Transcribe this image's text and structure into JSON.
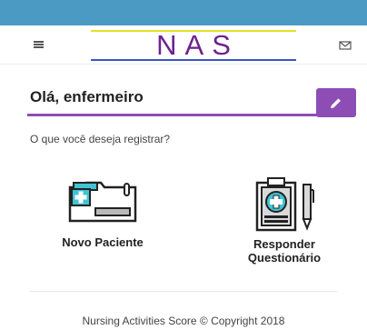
{
  "header": {
    "logo_text": "NAS",
    "menu_icon": "hamburger-menu-icon",
    "mail_icon": "envelope-icon"
  },
  "colors": {
    "topbar": "#4a9ac4",
    "accent": "#8e4db5",
    "logo_text": "#6b2390"
  },
  "greeting": {
    "text": "Olá, enfermeiro",
    "edit_icon": "pencil-icon"
  },
  "prompt": "O que você deseja registrar?",
  "options": [
    {
      "label_line1": "Novo Paciente",
      "label_line2": "",
      "icon": "patient-folder-icon"
    },
    {
      "label_line1": "Responder",
      "label_line2": "Questionário",
      "icon": "clipboard-pen-icon"
    }
  ],
  "footer": "Nursing Activities Score © Copyright 2018"
}
